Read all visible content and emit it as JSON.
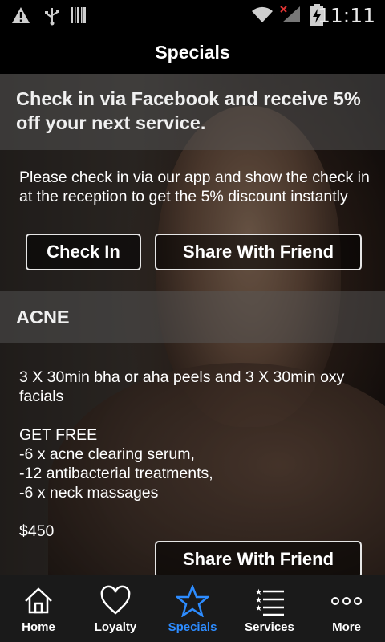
{
  "status_bar": {
    "time": "11:11",
    "icons": [
      "warning-icon",
      "usb-icon",
      "barcode-icon",
      "wifi-icon",
      "signal-icon",
      "battery-charging-icon"
    ]
  },
  "header": {
    "title": "Specials"
  },
  "specials": [
    {
      "title": "Check in via Facebook and receive 5% off your next service.",
      "description": "Please  check in via  our app and  show the check in at the  reception to get the 5% discount  instantly",
      "check_in_label": "Check In",
      "share_label": "Share With Friend"
    },
    {
      "title": "ACNE",
      "lines": [
        "3 X 30min bha or aha peels and 3 X 30min oxy",
        "facials",
        "GET FREE",
        "-6 x acne clearing serum,",
        "-12 antibacterial treatments,",
        "-6 x neck massages",
        "$450"
      ],
      "share_label": "Share With Friend"
    }
  ],
  "tab_bar": {
    "active": "Specials",
    "active_color": "#2d8cff",
    "tabs": [
      {
        "label": "Home",
        "icon": "home-icon"
      },
      {
        "label": "Loyalty",
        "icon": "heart-icon"
      },
      {
        "label": "Specials",
        "icon": "star-icon"
      },
      {
        "label": "Services",
        "icon": "list-icon"
      },
      {
        "label": "More",
        "icon": "more-dots-icon"
      }
    ]
  }
}
